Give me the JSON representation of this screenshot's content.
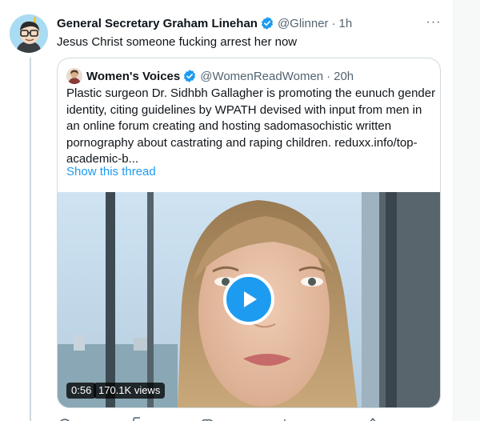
{
  "tweet": {
    "author_name": "General Secretary Graham Linehan",
    "handle": "@Glinner",
    "separator": "·",
    "time": "1h",
    "text": "Jesus Christ someone fucking arrest her now",
    "more_label": "···"
  },
  "quote": {
    "author_name": "Women's Voices",
    "handle": "@WomenReadWomen",
    "separator": "·",
    "time": "20h",
    "text": "Plastic surgeon Dr. Sidhbh Gallagher is promoting the eunuch gender identity, citing guidelines by WPATH devised with input from men in an online forum creating and hosting sadomasochistic written pornography about castrating and raping children. reduxx.info/top-academic-b...",
    "show_thread": "Show this thread",
    "video": {
      "duration": "0:56",
      "views": "170.1K views"
    }
  },
  "icons": {
    "verified": "verified-badge-icon",
    "play": "play-icon",
    "more": "more-icon"
  },
  "colors": {
    "accent": "#1d9bf0",
    "text": "#0f1419",
    "secondary": "#536471",
    "border": "#cfd9de"
  }
}
